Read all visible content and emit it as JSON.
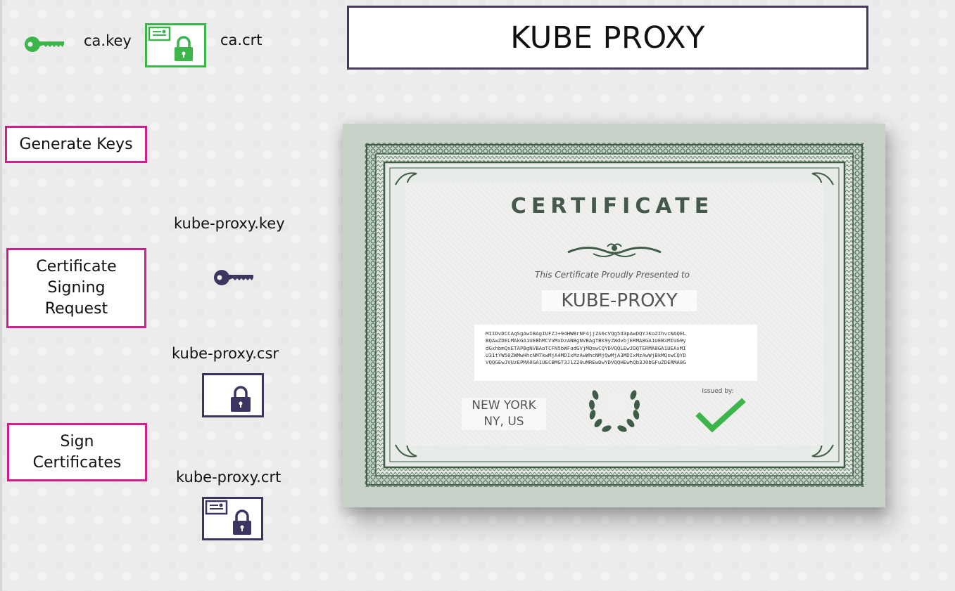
{
  "title": "KUBE PROXY",
  "ca": {
    "key_label": "ca.key",
    "crt_label": "ca.crt"
  },
  "steps": {
    "generate_keys": "Generate Keys",
    "csr_line1": "Certificate",
    "csr_line2": "Signing",
    "csr_line3": "Request",
    "sign_line1": "Sign",
    "sign_line2": "Certificates"
  },
  "files": {
    "key": "kube-proxy.key",
    "csr": "kube-proxy.csr",
    "crt": "kube-proxy.crt"
  },
  "certificate": {
    "heading": "CERTIFICATE",
    "subtitle": "This Certificate Proudly Presented to",
    "name": "KUBE-PROXY",
    "block_lines": [
      "MIIDvDCCAqSgAwIBAgIUFZJ+94HWBrNF4jjZS6cVQg5d3pAwDQYJKoZIhvcNAQEL",
      "BQAwZDELMAkGA1UEBhMCVVMxDzANBgNVBAgTBk9yZWdvbjERMA8GA1UEBxMIUG9y",
      "dGxhbmQxETAPBgNVBAoTCFN5bWFudGVjMQswCQYDVQQLEwJDQTERMA8GA1UEAxMI",
      "U31tYW50ZWMwHhcNMTkwMjA4MDIxMzAwWhcNMjQwMjA3MDIxMzAwWjBkMQswCQYD",
      "VQQGEwJVUzEPMA0GA1UECBMGT3J1Z29uMREwDwYDVQQHEwhQb3J0bGFuZDERMA8G"
    ],
    "city_line1": "NEW YORK",
    "city_line2": "NY, US",
    "issued_by": "Issued by:"
  },
  "colors": {
    "ca_green": "#3cb54a",
    "component_purple": "#3d3560",
    "step_border": "#d01e8c",
    "title_border": "#45395f",
    "cert_ink": "#44584b"
  },
  "icons": [
    "key-icon",
    "certificate-lock-icon",
    "lock-icon",
    "checkmark-icon",
    "laurel-wreath-icon",
    "ornament-icon"
  ]
}
